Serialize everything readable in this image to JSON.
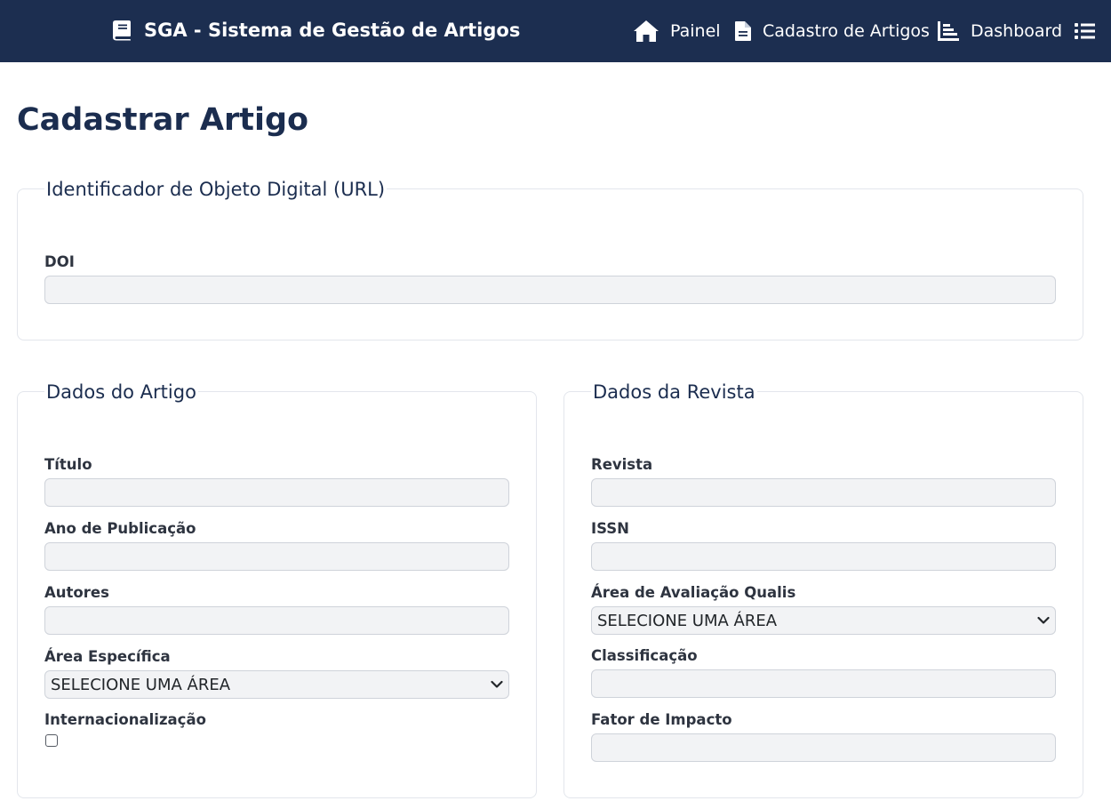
{
  "navbar": {
    "brand": "SGA - Sistema de Gestão de Artigos",
    "brand_icon": "book-icon",
    "items": [
      {
        "label": "Painel",
        "icon": "home-icon"
      },
      {
        "label": "Cadastro de Artigos",
        "icon": "document-icon"
      },
      {
        "label": "Dashboard",
        "icon": "chart-icon"
      },
      {
        "label": "",
        "icon": "list-icon"
      }
    ]
  },
  "page": {
    "title": "Cadastrar Artigo"
  },
  "doi_section": {
    "legend": "Identificador de Objeto Digital (URL)",
    "doi_label": "DOI",
    "doi_value": ""
  },
  "artigo_section": {
    "legend": "Dados do Artigo",
    "titulo_label": "Título",
    "ano_label": "Ano de Publicação",
    "autores_label": "Autores",
    "area_label": "Área Específica",
    "area_selected": "SELECIONE UMA ÁREA",
    "internacionalizacao_label": "Internacionalização",
    "internacionalizacao_checked": false
  },
  "revista_section": {
    "legend": "Dados da Revista",
    "revista_label": "Revista",
    "issn_label": "ISSN",
    "qualis_label": "Área de Avaliação Qualis",
    "qualis_selected": "SELECIONE UMA ÁREA",
    "classificacao_label": "Classificação",
    "fator_label": "Fator de Impacto"
  },
  "colors": {
    "navbar_bg": "#1c2e50",
    "title_text": "#1b2d4f",
    "input_bg": "#f2f3f5"
  }
}
